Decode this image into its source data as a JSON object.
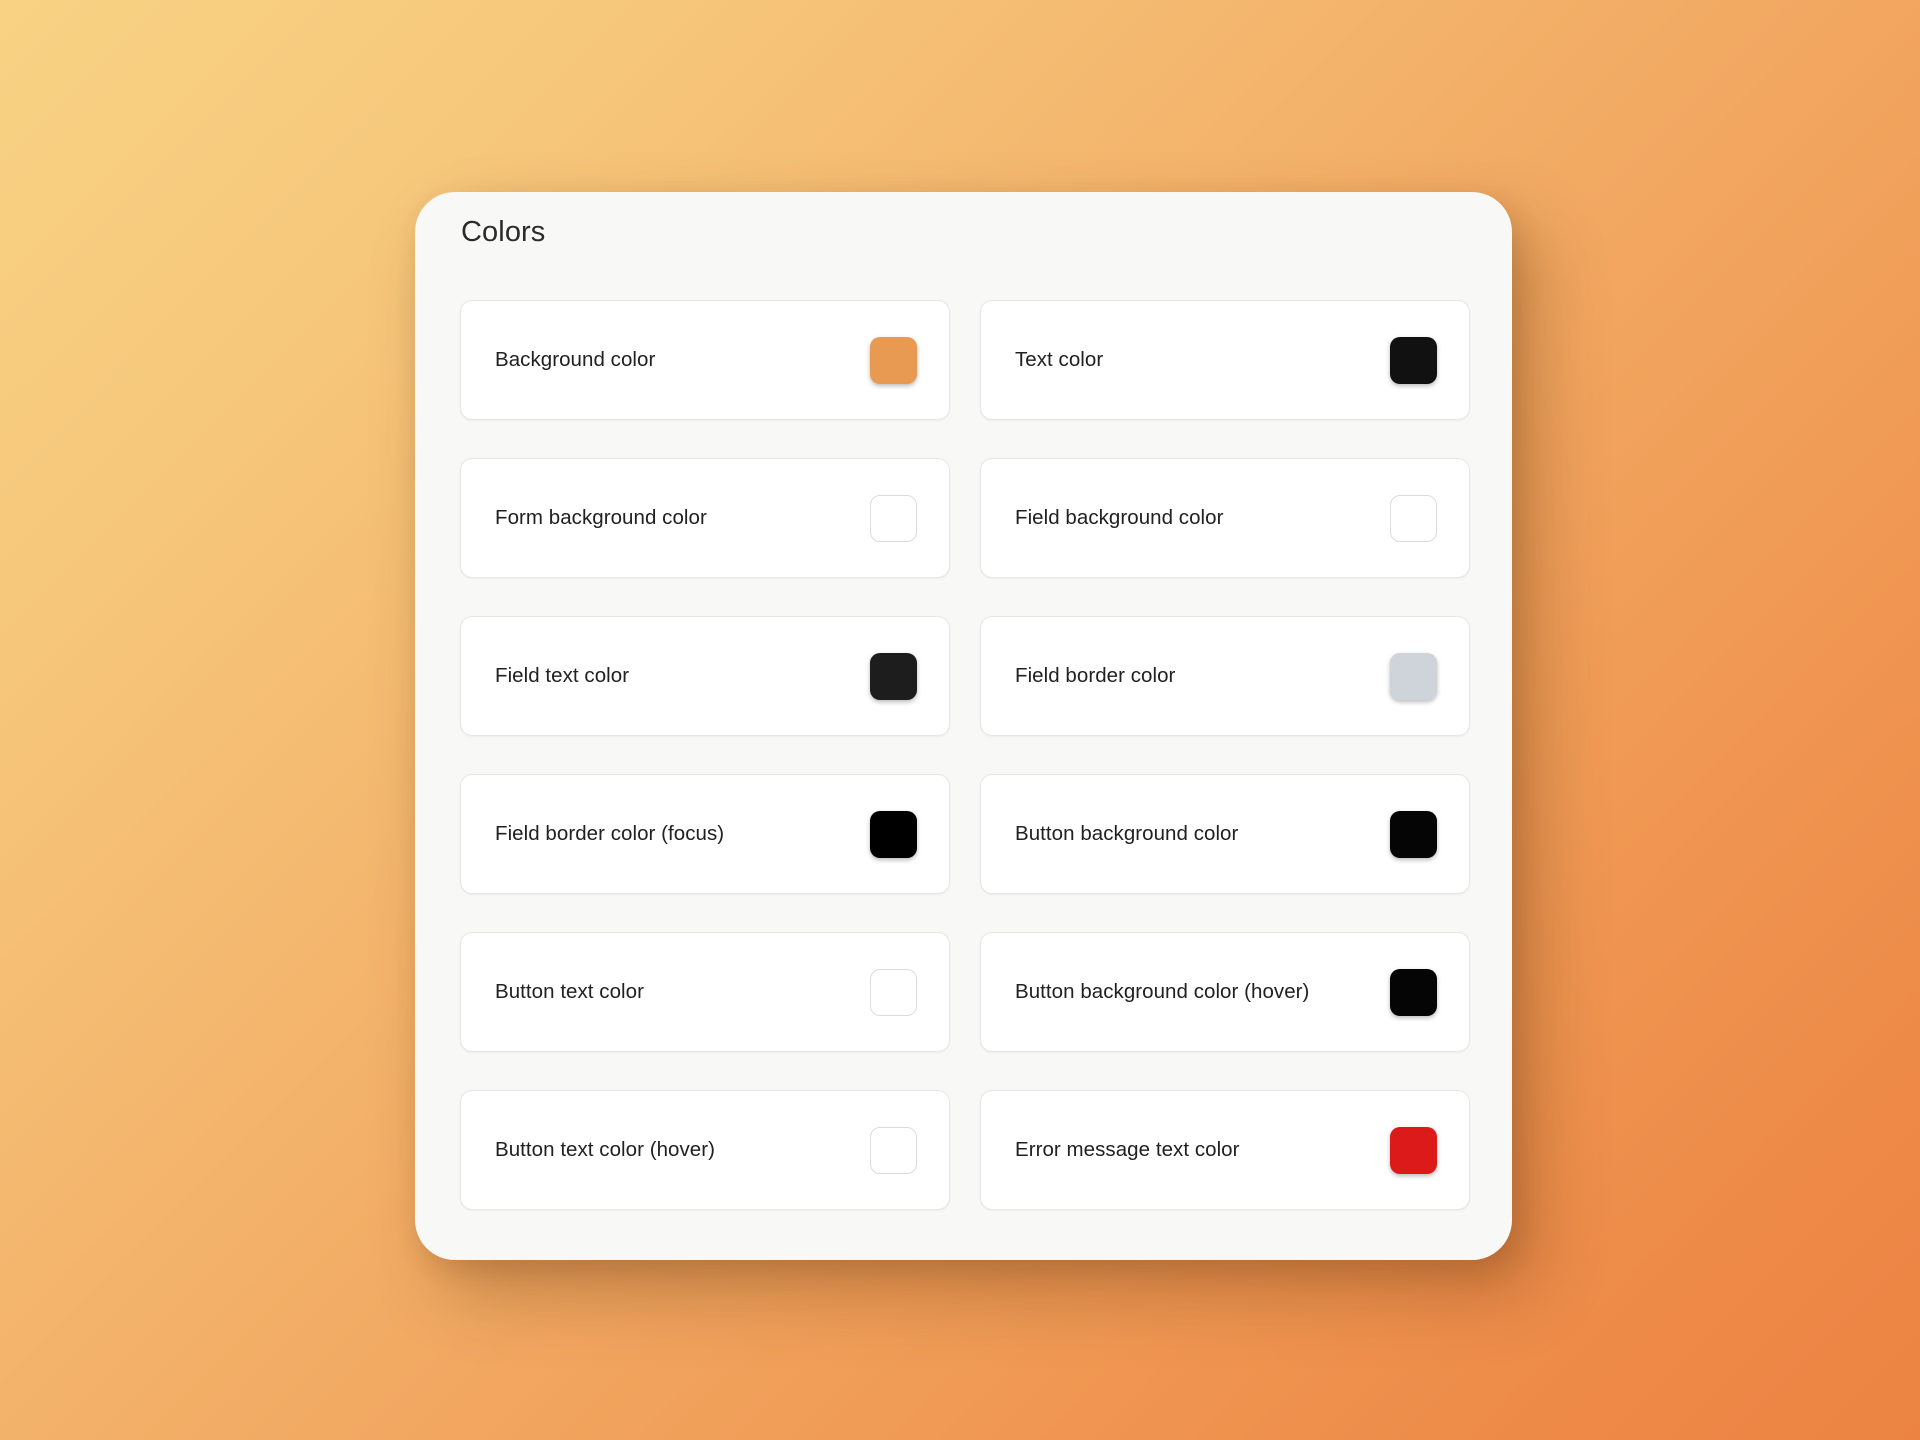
{
  "background": {
    "gradient_from": "#f9d284",
    "gradient_to": "#ec8343",
    "direction": "135deg"
  },
  "card": {
    "title": "Colors",
    "background": "#f8f8f7"
  },
  "swatch_rows": [
    {
      "label": "Background color",
      "color": "#e89a52",
      "empty": false
    },
    {
      "label": "Text color",
      "color": "#111111",
      "empty": false
    },
    {
      "label": "Form background color",
      "color": "#ffffff",
      "empty": true
    },
    {
      "label": "Field background color",
      "color": "#ffffff",
      "empty": true
    },
    {
      "label": "Field text color",
      "color": "#1d1d1d",
      "empty": false
    },
    {
      "label": "Field border color",
      "color": "#ced4da",
      "empty": false
    },
    {
      "label": "Field border color (focus)",
      "color": "#000000",
      "empty": false
    },
    {
      "label": "Button background color",
      "color": "#050505",
      "empty": false
    },
    {
      "label": "Button text color",
      "color": "#ffffff",
      "empty": true
    },
    {
      "label": "Button background color (hover)",
      "color": "#050505",
      "empty": false
    },
    {
      "label": "Button text color (hover)",
      "color": "#ffffff",
      "empty": true
    },
    {
      "label": "Error message text color",
      "color": "#dc1a1a",
      "empty": false
    }
  ]
}
